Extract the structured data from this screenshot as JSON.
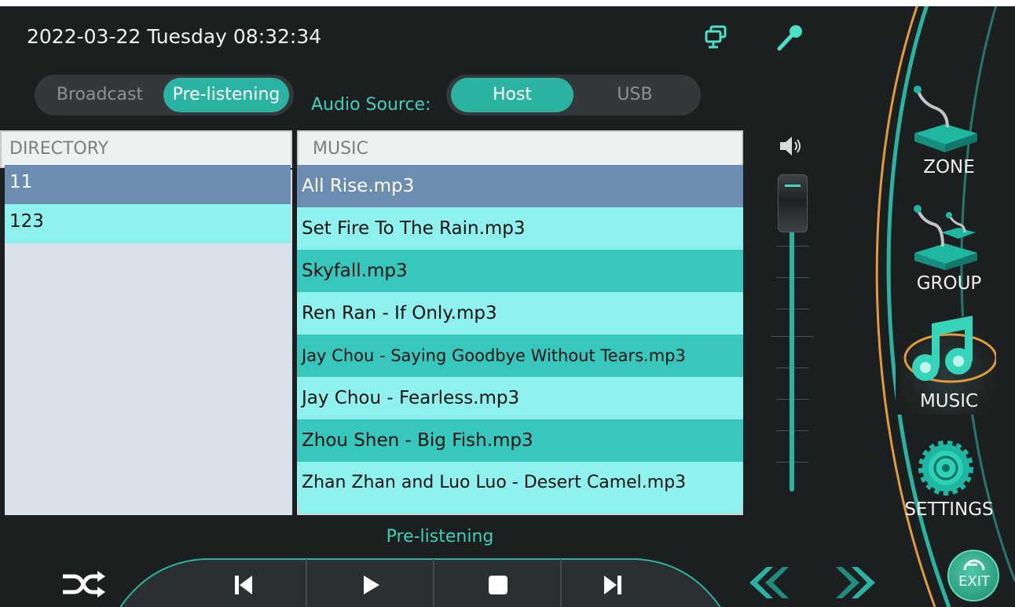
{
  "header": {
    "datetime": "2022-03-22 Tuesday 08:32:34",
    "icons": [
      "monitor-icon",
      "microphone-icon"
    ]
  },
  "mode_toggle": {
    "options": [
      "Broadcast",
      "Pre-listening"
    ],
    "selected": "Pre-listening"
  },
  "audio_source": {
    "label": "Audio Source:",
    "options": [
      "Host",
      "USB"
    ],
    "selected": "Host"
  },
  "directory": {
    "header": "DIRECTORY",
    "items": [
      "11",
      "123"
    ],
    "selected": "11"
  },
  "music": {
    "header": "MUSIC",
    "items": [
      "All Rise.mp3",
      "Set Fire To The Rain.mp3",
      "Skyfall.mp3",
      "Ren Ran - If Only.mp3",
      "Jay Chou - Saying Goodbye Without Tears.mp3",
      "Jay Chou - Fearless.mp3",
      "Zhou Shen - Big Fish.mp3",
      "Zhan Zhan and Luo Luo - Desert Camel.mp3"
    ],
    "selected": "All Rise.mp3"
  },
  "volume": {
    "icon": "speaker-icon",
    "level": 1.0
  },
  "sidebar": {
    "items": [
      {
        "label": "ZONE",
        "icon": "gooseneck-mic-icon"
      },
      {
        "label": "GROUP",
        "icon": "group-mic-icon"
      },
      {
        "label": "MUSIC",
        "icon": "music-note-icon"
      },
      {
        "label": "SETTINGS",
        "icon": "gear-icon"
      }
    ],
    "active": "MUSIC"
  },
  "status": {
    "text": "Pre-listening"
  },
  "transport": {
    "icons": [
      "shuffle-icon",
      "previous-icon",
      "play-icon",
      "stop-icon",
      "next-icon"
    ]
  },
  "exit": {
    "label": "EXIT"
  },
  "colors": {
    "accent": "#2bb3a1",
    "background": "#1c1f20",
    "row_selected": "#6a8db1",
    "row_dark": "#37c7bd",
    "row_light": "#8ff1ee",
    "directory_bg": "#d9e2ec"
  }
}
